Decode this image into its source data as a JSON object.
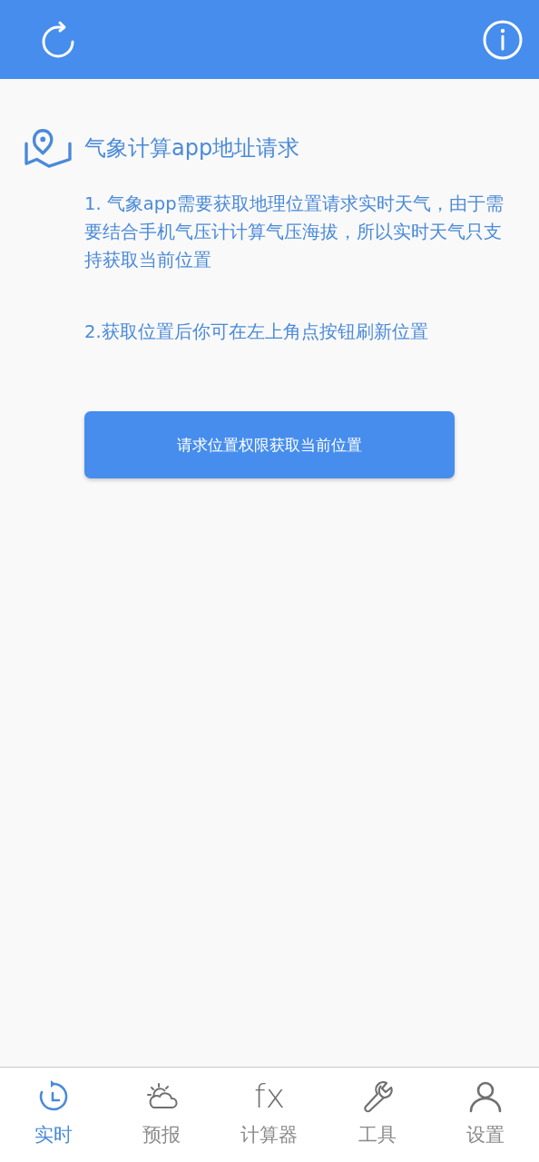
{
  "header": {
    "buttons": [
      {
        "kind": "refresh"
      },
      {
        "kind": "info"
      }
    ]
  },
  "title": "气象计算app地址请求",
  "paragraphs": [
    "1. 气象app需要获取地理位置请求实时天气，由于需要结合手机气压计计算气压海拔，所以实时天气只支持获取当前位置",
    "2.获取位置后你可在左上角点按钮刷新位置"
  ],
  "button": "请求位置权限获取当前位置",
  "tabs": [
    {
      "kind": "clock",
      "label": "实时",
      "selected": true
    },
    {
      "kind": "weather",
      "label": "预报",
      "selected": false
    },
    {
      "kind": "glyph",
      "glyph": "fx",
      "label": "计算器",
      "selected": false
    },
    {
      "kind": "wrench",
      "label": "工具",
      "selected": false
    },
    {
      "kind": "person",
      "label": "设置",
      "selected": false
    }
  ]
}
